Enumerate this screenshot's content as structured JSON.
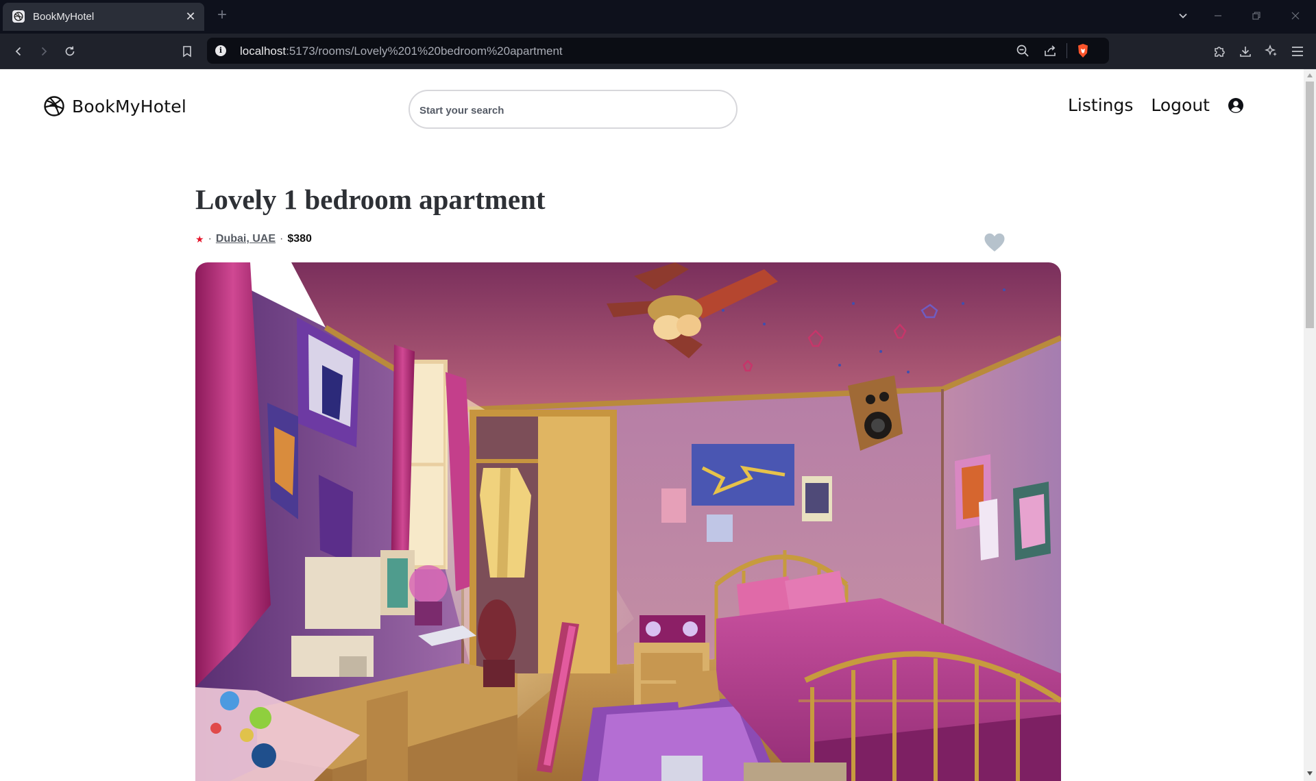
{
  "browser": {
    "tab_title": "BookMyHotel",
    "new_tab_symbol": "+",
    "tab_close_symbol": "✕",
    "url_host": "localhost",
    "url_path": ":5173/rooms/Lovely%201%20bedroom%20apartment",
    "icons": [
      "back-icon",
      "forward-icon",
      "reload-icon",
      "bookmark-icon",
      "site-info-icon",
      "zoom-icon",
      "share-icon",
      "brave-shield-icon",
      "extensions-icon",
      "download-icon",
      "leo-ai-icon",
      "menu-icon"
    ]
  },
  "header": {
    "logo_text": "BookMyHotel",
    "search_placeholder": "Start your search",
    "nav": {
      "listings": "Listings",
      "logout": "Logout"
    }
  },
  "listing": {
    "title": "Lovely 1 bedroom apartment",
    "rating_symbol": "★",
    "separator": "·",
    "location": "Dubai, UAE",
    "price": "$380",
    "favorite_color": "#b6c2cc"
  },
  "colors": {
    "rating_star": "#e5142a",
    "chrome_dark": "#0e111c"
  }
}
